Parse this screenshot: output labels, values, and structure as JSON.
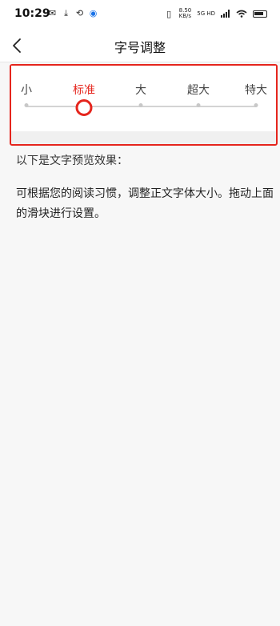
{
  "status_bar": {
    "time": "10:29",
    "left_icons": [
      "message-icon",
      "download-icon",
      "sync-icon",
      "location-dot-icon"
    ],
    "speed_value": "8.50",
    "speed_unit": "KB/s",
    "network": "5G HD",
    "right_icons": [
      "vibrate-icon",
      "signal-icon",
      "wifi-icon",
      "battery-icon"
    ]
  },
  "header": {
    "title": "字号调整",
    "back_icon": "chevron-left-icon"
  },
  "slider": {
    "levels": [
      "小",
      "标准",
      "大",
      "超大",
      "特大"
    ],
    "selected_index": 1,
    "accent_color": "#e5251d"
  },
  "preview": {
    "heading": "以下是文字预览效果：",
    "body": "可根据您的阅读习惯，调整正文字体大小。拖动上面的滑块进行设置。"
  }
}
